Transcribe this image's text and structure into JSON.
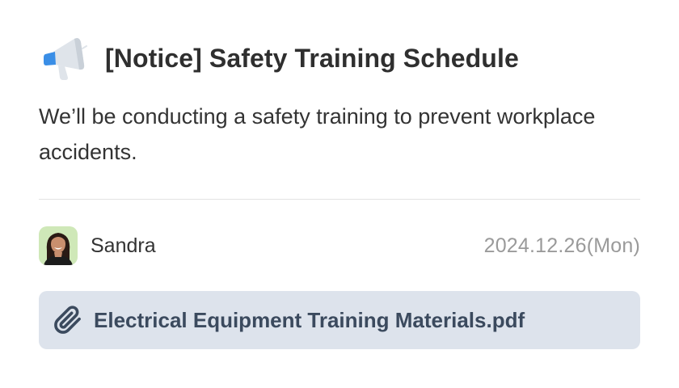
{
  "notice": {
    "icon": "megaphone-icon",
    "title": "[Notice] Safety Training Schedule",
    "body": "We’ll be conducting a safety training to prevent workplace accidents."
  },
  "author": {
    "name": "Sandra",
    "avatar": "avatar-photo"
  },
  "date": "2024.12.26(Mon)",
  "attachment": {
    "icon": "paperclip-icon",
    "filename": "Electrical Equipment Training Materials.pdf"
  },
  "colors": {
    "megaphone_accent": "#3a8ee6",
    "attachment_bg": "#dde3ec",
    "attachment_text": "#3b4a5e",
    "date_text": "#9a9a9a"
  }
}
